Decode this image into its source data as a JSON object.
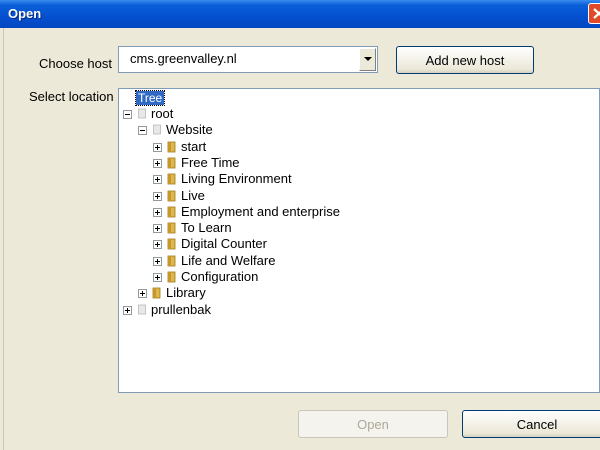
{
  "window": {
    "title": "Open"
  },
  "form": {
    "host_label": "Choose host",
    "host_value": "cms.greenvalley.nl",
    "add_host_label": "Add new host",
    "location_label": "Select location"
  },
  "tree": {
    "root_label": "Tree",
    "nodes": [
      {
        "label": "root",
        "icon": "page-icon",
        "expander": "minus"
      },
      {
        "label": "Website",
        "icon": "page-icon",
        "expander": "minus"
      },
      {
        "label": "start",
        "icon": "folder-icon",
        "expander": "plus"
      },
      {
        "label": "Free Time",
        "icon": "folder-icon",
        "expander": "plus"
      },
      {
        "label": "Living Environment",
        "icon": "folder-icon",
        "expander": "plus"
      },
      {
        "label": "Live",
        "icon": "folder-icon",
        "expander": "plus"
      },
      {
        "label": "Employment and enterprise",
        "icon": "folder-icon",
        "expander": "plus"
      },
      {
        "label": "To Learn",
        "icon": "folder-icon",
        "expander": "plus"
      },
      {
        "label": "Digital Counter",
        "icon": "folder-icon",
        "expander": "plus"
      },
      {
        "label": "Life and Welfare",
        "icon": "folder-icon",
        "expander": "plus"
      },
      {
        "label": "Configuration",
        "icon": "folder-icon",
        "expander": "plus"
      },
      {
        "label": "Library",
        "icon": "folder-icon",
        "expander": "plus"
      },
      {
        "label": "prullenbak",
        "icon": "page-icon",
        "expander": "plus"
      }
    ]
  },
  "footer": {
    "open_label": "Open",
    "cancel_label": "Cancel"
  },
  "colors": {
    "titlebar": "#0450d0",
    "selection": "#316ac5",
    "folder": "#e0b84a",
    "close": "#e04a2a"
  }
}
